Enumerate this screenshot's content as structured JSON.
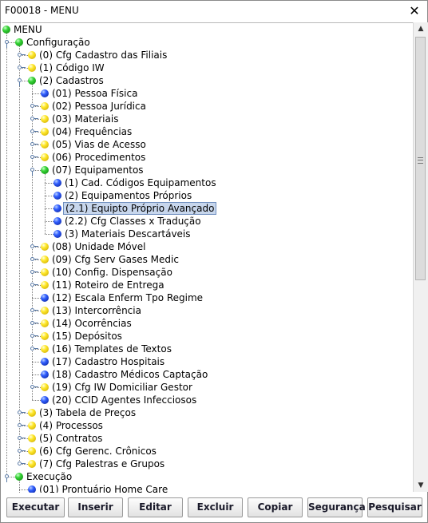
{
  "window": {
    "title": "F00018 - MENU",
    "close_label": "✕"
  },
  "tree": {
    "nodes": [
      {
        "label": "MENU",
        "depth": 0,
        "dot": "green",
        "handle": "none"
      },
      {
        "label": "Configuração",
        "depth": 1,
        "dot": "green",
        "handle": "expanded"
      },
      {
        "label": "(0) Cfg Cadastro das Filiais",
        "depth": 2,
        "dot": "yellow",
        "handle": "collapsed"
      },
      {
        "label": "(1) Código IW",
        "depth": 2,
        "dot": "yellow",
        "handle": "collapsed"
      },
      {
        "label": "(2) Cadastros",
        "depth": 2,
        "dot": "green",
        "handle": "expanded"
      },
      {
        "label": "(01) Pessoa Física",
        "depth": 3,
        "dot": "blue",
        "handle": "none"
      },
      {
        "label": "(02) Pessoa Jurídica",
        "depth": 3,
        "dot": "yellow",
        "handle": "collapsed"
      },
      {
        "label": "(03) Materiais",
        "depth": 3,
        "dot": "yellow",
        "handle": "collapsed"
      },
      {
        "label": "(04) Frequências",
        "depth": 3,
        "dot": "yellow",
        "handle": "collapsed"
      },
      {
        "label": "(05) Vias de Acesso",
        "depth": 3,
        "dot": "yellow",
        "handle": "collapsed"
      },
      {
        "label": "(06) Procedimentos",
        "depth": 3,
        "dot": "yellow",
        "handle": "collapsed"
      },
      {
        "label": "(07) Equipamentos",
        "depth": 3,
        "dot": "green",
        "handle": "expanded"
      },
      {
        "label": "(1) Cad. Códigos Equipamentos",
        "depth": 4,
        "dot": "blue",
        "handle": "none"
      },
      {
        "label": "(2) Equipamentos Próprios",
        "depth": 4,
        "dot": "blue",
        "handle": "none"
      },
      {
        "label": "(2.1) Equipto Próprio Avançado",
        "depth": 4,
        "dot": "blue",
        "handle": "none",
        "selected": true
      },
      {
        "label": "(2.2) Cfg Classes x Tradução",
        "depth": 4,
        "dot": "blue",
        "handle": "none"
      },
      {
        "label": "(3) Materiais Descartáveis",
        "depth": 4,
        "dot": "blue",
        "handle": "none"
      },
      {
        "label": "(08) Unidade Móvel",
        "depth": 3,
        "dot": "yellow",
        "handle": "collapsed"
      },
      {
        "label": "(09) Cfg Serv Gases Medic",
        "depth": 3,
        "dot": "yellow",
        "handle": "collapsed"
      },
      {
        "label": "(10) Config. Dispensação",
        "depth": 3,
        "dot": "yellow",
        "handle": "collapsed"
      },
      {
        "label": "(11) Roteiro de Entrega",
        "depth": 3,
        "dot": "yellow",
        "handle": "collapsed"
      },
      {
        "label": "(12) Escala Enferm Tpo Regime",
        "depth": 3,
        "dot": "blue",
        "handle": "none"
      },
      {
        "label": "(13) Intercorrência",
        "depth": 3,
        "dot": "yellow",
        "handle": "collapsed"
      },
      {
        "label": "(14) Ocorrências",
        "depth": 3,
        "dot": "yellow",
        "handle": "collapsed"
      },
      {
        "label": "(15) Depósitos",
        "depth": 3,
        "dot": "yellow",
        "handle": "collapsed"
      },
      {
        "label": "(16) Templates de Textos",
        "depth": 3,
        "dot": "yellow",
        "handle": "collapsed"
      },
      {
        "label": "(17) Cadastro Hospitais",
        "depth": 3,
        "dot": "blue",
        "handle": "none"
      },
      {
        "label": "(18) Cadastro Médicos Captação",
        "depth": 3,
        "dot": "blue",
        "handle": "none"
      },
      {
        "label": "(19) Cfg IW Domiciliar Gestor",
        "depth": 3,
        "dot": "yellow",
        "handle": "collapsed"
      },
      {
        "label": "(20) CCID Agentes Infecciosos",
        "depth": 3,
        "dot": "blue",
        "handle": "none"
      },
      {
        "label": "(3) Tabela de Preços",
        "depth": 2,
        "dot": "yellow",
        "handle": "collapsed"
      },
      {
        "label": "(4) Processos",
        "depth": 2,
        "dot": "yellow",
        "handle": "collapsed"
      },
      {
        "label": "(5) Contratos",
        "depth": 2,
        "dot": "yellow",
        "handle": "collapsed"
      },
      {
        "label": "(6) Cfg Gerenc. Crônicos",
        "depth": 2,
        "dot": "yellow",
        "handle": "collapsed"
      },
      {
        "label": "(7) Cfg Palestras e Grupos",
        "depth": 2,
        "dot": "yellow",
        "handle": "collapsed"
      },
      {
        "label": "Execução",
        "depth": 1,
        "dot": "green",
        "handle": "expanded"
      },
      {
        "label": "(01) Prontuário Home Care",
        "depth": 2,
        "dot": "blue",
        "handle": "none"
      }
    ]
  },
  "scrollbar": {
    "up_label": "▲",
    "down_label": "▼",
    "position": 0
  },
  "buttons": [
    {
      "id": "executar",
      "label": "Executar"
    },
    {
      "id": "inserir",
      "label": "Inserir"
    },
    {
      "id": "editar",
      "label": "Editar"
    },
    {
      "id": "excluir",
      "label": "Excluir"
    },
    {
      "id": "copiar",
      "label": "Copiar"
    },
    {
      "id": "seguranca",
      "label": "Segurança"
    },
    {
      "id": "pesquisar",
      "label": "Pesquisar"
    }
  ]
}
